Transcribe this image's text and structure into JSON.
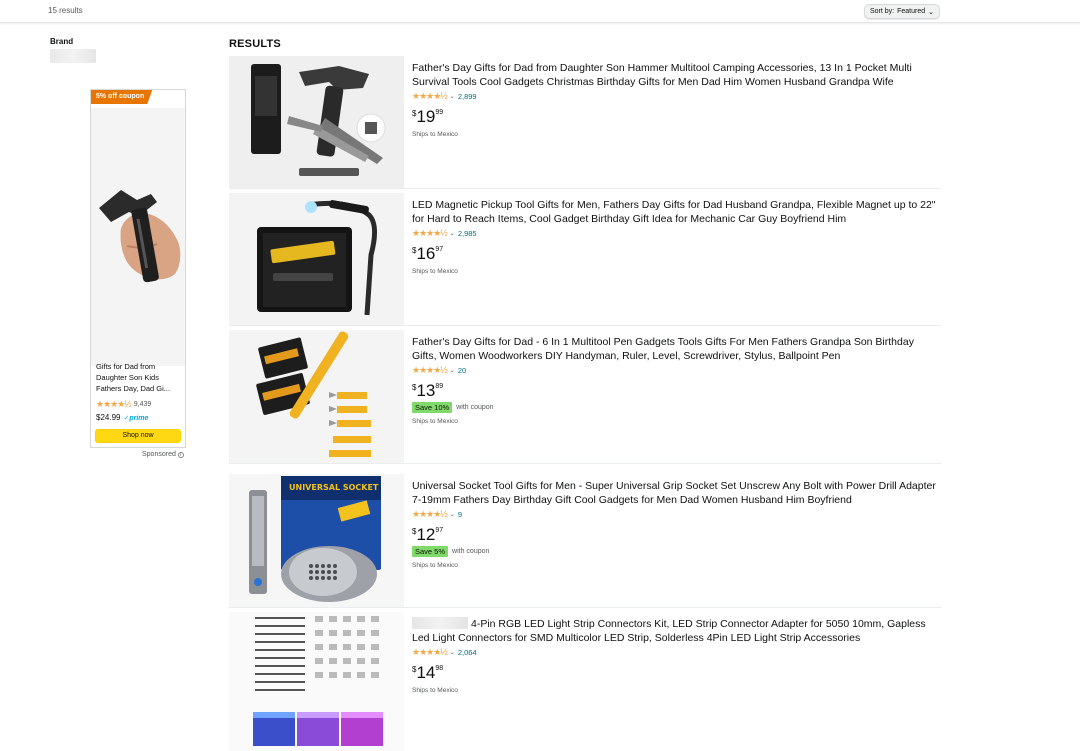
{
  "topbar": {
    "results_count": "15 results",
    "sort_label": "Sort by:",
    "sort_value": "Featured"
  },
  "sidebar": {
    "brand_heading": "Brand"
  },
  "ad": {
    "badge": "5% off coupon",
    "title": "Gifts for Dad from Daughter Son Kids Fathers Day, Dad Gi...",
    "stars": "★★★★½",
    "rating_count": "9,439",
    "price": "$24.99",
    "prime": "✓prime",
    "button": "Shop now",
    "sponsored": "Sponsored"
  },
  "results": {
    "heading": "RESULTS",
    "items": [
      {
        "title": "Father's Day Gifts for Dad from Daughter Son Hammer Multitool Camping Accessories, 13 In 1 Pocket Multi Survival Tools Cool Gadgets Christmas Birthday Gifts for Men Dad Him Women Husband Grandpa Wife",
        "stars": "★★★★½",
        "rating_count": "2,899",
        "price_symbol": "$",
        "price_whole": "19",
        "price_fraction": "99",
        "ships": "Ships to Mexico"
      },
      {
        "title": "LED Magnetic Pickup Tool Gifts for Men, Fathers Day Gifts for Dad Husband Grandpa, Flexible Magnet up to 22\" for Hard to Reach Items, Cool Gadget Birthday Gift Idea for Mechanic Car Guy Boyfriend Him",
        "stars": "★★★★½",
        "rating_count": "2,985",
        "price_symbol": "$",
        "price_whole": "16",
        "price_fraction": "97",
        "ships": "Ships to Mexico"
      },
      {
        "title": "Father's Day Gifts for Dad - 6 In 1 Multitool Pen Gadgets Tools Gifts For Men Fathers Grandpa Son Birthday Gifts, Women Woodworkers DIY Handyman, Ruler, Level, Screwdriver, Stylus, Ballpoint Pen",
        "stars": "★★★★½",
        "rating_count": "20",
        "price_symbol": "$",
        "price_whole": "13",
        "price_fraction": "89",
        "coupon": "Save 10%",
        "coupon_suffix": "with coupon",
        "ships": "Ships to Mexico"
      },
      {
        "title": "Universal Socket Tool Gifts for Men - Super Universal Grip Socket Set Unscrew Any Bolt with Power Drill Adapter 7-19mm Fathers Day Birthday Gift Cool Gadgets for Men Dad Women Husband Him Boyfriend",
        "stars": "★★★★½",
        "rating_count": "9",
        "price_symbol": "$",
        "price_whole": "12",
        "price_fraction": "97",
        "coupon": "Save 5%",
        "coupon_suffix": "with coupon",
        "ships": "Ships to Mexico"
      },
      {
        "title": "4-Pin RGB LED Light Strip Connectors Kit, LED Strip Connector Adapter for 5050 10mm, Gapless Led Light Connectors for SMD Multicolor LED Strip, Solderless 4Pin LED Light Strip Accessories",
        "stars": "★★★★½",
        "rating_count": "2,064",
        "price_symbol": "$",
        "price_whole": "14",
        "price_fraction": "98",
        "ships": "Ships to Mexico"
      }
    ],
    "image_texts": {
      "socket_box": "UNIVERSAL SOCKET"
    }
  },
  "colors": {
    "coupon_orange": "#e77600",
    "star": "#f3a847",
    "link": "#007185",
    "button_yellow": "#ffd814",
    "save_green": "#7fda69"
  }
}
